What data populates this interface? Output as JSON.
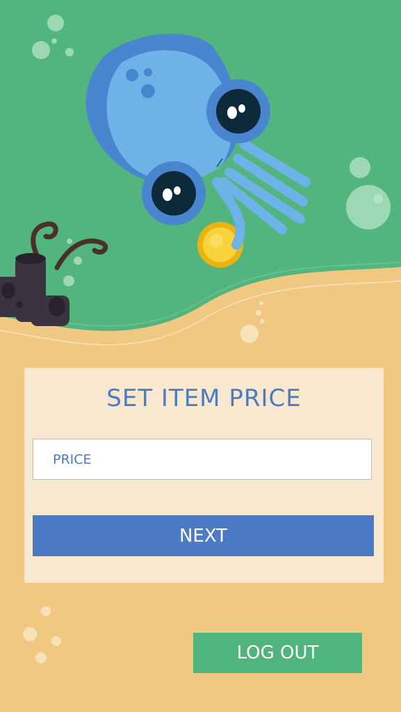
{
  "screen": {
    "title": "SET ITEM PRICE"
  },
  "price_field": {
    "placeholder": "PRICE",
    "value": ""
  },
  "next_button": {
    "label": "NEXT"
  },
  "logout_button": {
    "label": "LOG OUT"
  },
  "colors": {
    "water": "#52B57E",
    "sand": "#F0C882",
    "card": "#F8E8D0",
    "accent_blue": "#4A7BC4",
    "logout_green": "#50B57C",
    "squid_body": "#6DB3E8",
    "coin": "#F5C518"
  },
  "illustration": {
    "icons": [
      "squid-illustration",
      "gold-coin-icon",
      "coral-illustration",
      "bubble-icon"
    ]
  }
}
